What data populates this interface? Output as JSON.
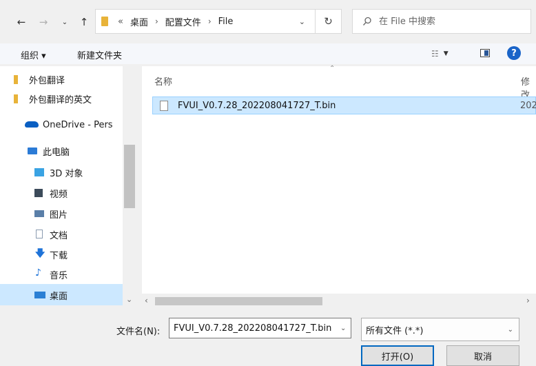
{
  "address_bar": {
    "crumbs": [
      "桌面",
      "配置文件",
      "File"
    ],
    "overflow_glyph": "«",
    "separator": "›"
  },
  "search": {
    "placeholder": "在 File 中搜索"
  },
  "toolbar": {
    "organize_label": "组织 ▾",
    "new_folder_label": "新建文件夹"
  },
  "nav_pane": {
    "items": [
      {
        "label": "外包翻译",
        "icon": "folder-icon"
      },
      {
        "label": "外包翻译的英文",
        "icon": "folder-icon"
      },
      {
        "label": "OneDrive - Pers",
        "icon": "cloud-icon"
      },
      {
        "label": "此电脑",
        "icon": "computer-icon"
      },
      {
        "label": "3D 对象",
        "icon": "3d-objects-icon"
      },
      {
        "label": "视频",
        "icon": "video-icon"
      },
      {
        "label": "图片",
        "icon": "pictures-icon"
      },
      {
        "label": "文档",
        "icon": "documents-icon"
      },
      {
        "label": "下载",
        "icon": "download-icon"
      },
      {
        "label": "音乐",
        "icon": "music-icon"
      },
      {
        "label": "桌面",
        "icon": "desktop-icon"
      }
    ]
  },
  "file_list": {
    "columns": [
      "名称",
      "修改"
    ],
    "files": [
      {
        "name": "FVUI_V0.7.28_202208041727_T.bin",
        "date": "202"
      }
    ]
  },
  "bottom": {
    "filename_label": "文件名(N):",
    "filename_value": "FVUI_V0.7.28_202208041727_T.bin",
    "filetype_value": "所有文件 (*.*)",
    "open_label": "打开(O)",
    "cancel_label": "取消"
  },
  "colors": {
    "selection": "#cce8ff",
    "selection_border": "#99d1ff",
    "folder": "#e8b339",
    "accent": "#0067c0"
  }
}
